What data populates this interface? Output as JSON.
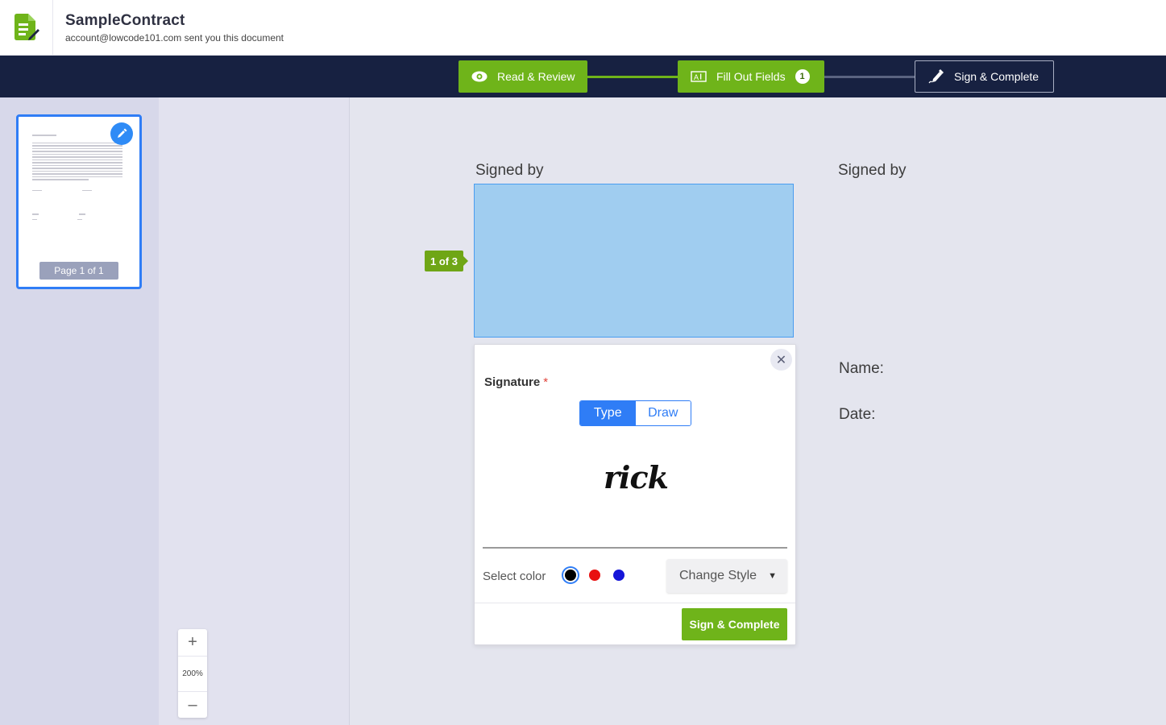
{
  "header": {
    "title": "SampleContract",
    "subtitle": "account@lowcode101.com sent you this document"
  },
  "steps": [
    {
      "label": "Read & Review",
      "icon": "eye-icon",
      "state": "done"
    },
    {
      "label": "Fill Out Fields",
      "icon": "text-field-icon",
      "badge": "1",
      "state": "done"
    },
    {
      "label": "Sign & Complete",
      "icon": "pen-icon",
      "state": "current"
    }
  ],
  "sidebar": {
    "page_label": "Page 1 of 1"
  },
  "zoom": {
    "in": "+",
    "level": "200%",
    "out": "–"
  },
  "document": {
    "signed_by_left": "Signed by",
    "signed_by_right": "Signed by",
    "field_tag": "1 of 3",
    "name_label": "Name:",
    "date_label": "Date:"
  },
  "popup": {
    "close": "✕",
    "signature_label": "Signature",
    "required_mark": "*",
    "tabs": [
      "Type",
      "Draw"
    ],
    "active_tab": "Type",
    "signature_text": "rick",
    "select_color_label": "Select color",
    "colors": [
      "#000000",
      "#e81010",
      "#1515d8"
    ],
    "selected_color": "#000000",
    "change_style_label": "Change Style",
    "sign_complete_label": "Sign & Complete"
  },
  "colors": {
    "accent_green": "#6fb41a",
    "nav_bg": "#172141",
    "primary_blue": "#2f7df6",
    "field_blue": "#a0cdf0"
  }
}
